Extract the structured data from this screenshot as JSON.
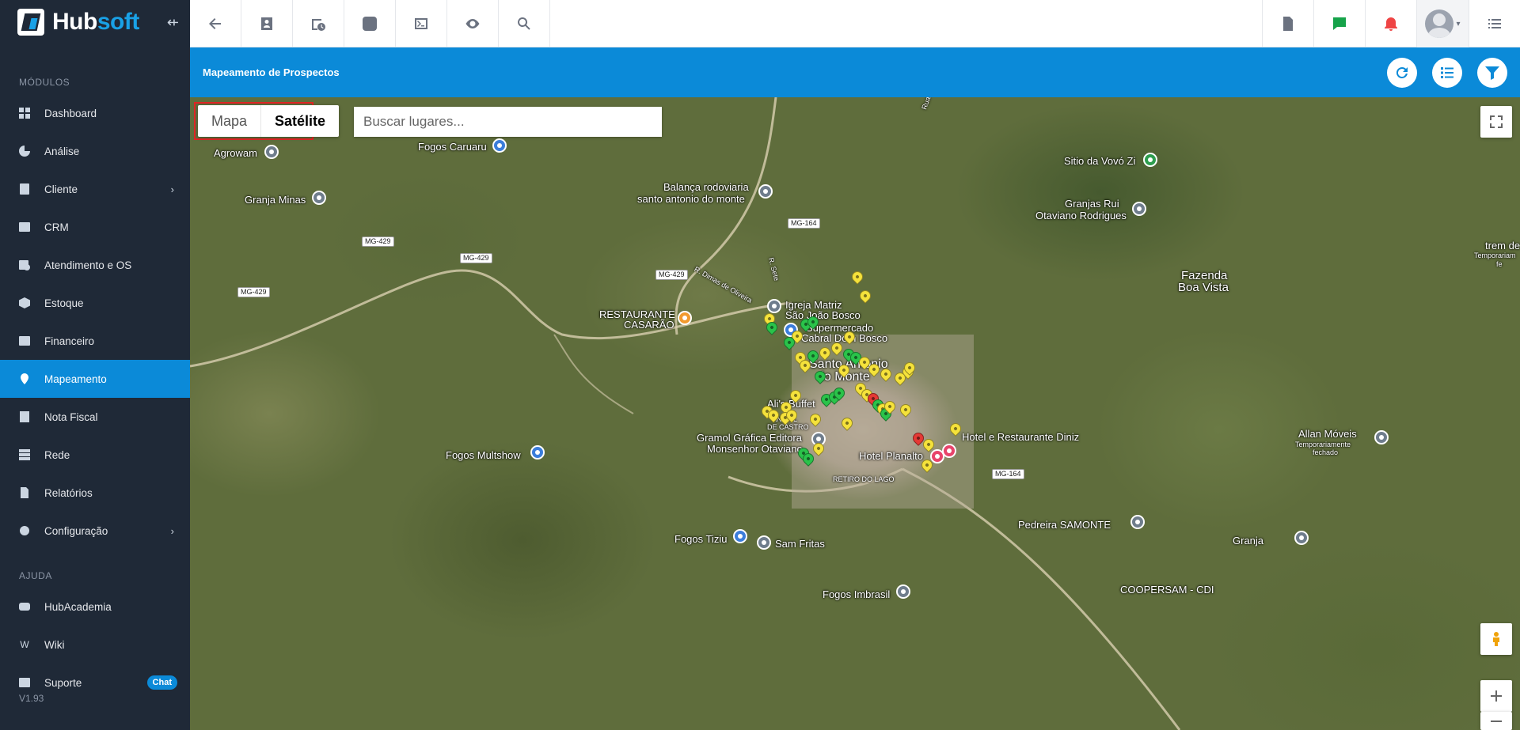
{
  "brand": {
    "name_a": "Hub",
    "name_b": "soft"
  },
  "sidebar": {
    "section_modules": "MÓDULOS",
    "items": [
      {
        "label": "Dashboard",
        "icon": "dashboard-icon"
      },
      {
        "label": "Análise",
        "icon": "pie-chart-icon"
      },
      {
        "label": "Cliente",
        "icon": "id-card-icon",
        "has_children": true
      },
      {
        "label": "CRM",
        "icon": "crm-icon"
      },
      {
        "label": "Atendimento e OS",
        "icon": "calendar-clock-icon"
      },
      {
        "label": "Estoque",
        "icon": "box-icon"
      },
      {
        "label": "Financeiro",
        "icon": "money-icon"
      },
      {
        "label": "Mapeamento",
        "icon": "map-pin-icon",
        "active": true
      },
      {
        "label": "Nota Fiscal",
        "icon": "invoice-icon"
      },
      {
        "label": "Rede",
        "icon": "network-icon"
      },
      {
        "label": "Relatórios",
        "icon": "report-icon"
      },
      {
        "label": "Configuração",
        "icon": "gear-icon",
        "has_children": true
      }
    ],
    "section_help": "AJUDA",
    "help_items": [
      {
        "label": "HubAcademia",
        "icon": "youtube-icon"
      },
      {
        "label": "Wiki",
        "icon": "wikipedia-icon"
      },
      {
        "label": "Suporte",
        "icon": "chat-icon",
        "badge": "Chat"
      }
    ],
    "version": "V1.93"
  },
  "page": {
    "title": "Mapeamento de Prospectos"
  },
  "map": {
    "map_type_map": "Mapa",
    "map_type_satellite": "Satélite",
    "search_placeholder": "Buscar lugares...",
    "places": {
      "agrowam": "Agrowam",
      "fogos_caruaru": "Fogos Caruaru",
      "granja_minas": "Granja Minas",
      "balanca_1": "Balança rodoviaria",
      "balanca_2": "santo antonio do monte",
      "sitio": "Sitio da Vovó Zi",
      "granjas_1": "Granjas Rui",
      "granjas_2": "Otaviano Rodrigues",
      "fazenda_1": "Fazenda",
      "fazenda_2": "Boa Vista",
      "trem_1": "trem de",
      "trem_2": "Temporariam",
      "trem_3": "fe",
      "igreja_1": "Igreja Matriz",
      "igreja_2": "São João Bosco",
      "super_1": "Supermercado",
      "super_2": "Cabral Dom Bosco",
      "rest_1": "RESTAURANTE",
      "rest_2": "CASARÃO",
      "city_1": "Santo Antonio",
      "city_2": "do Monte",
      "buffet": "Ali's Buffet",
      "anibal_1": "ANIBAL",
      "anibal_2": "DE CASTRO",
      "gramol_1": "Gramol Gráfica Editora",
      "gramol_2": "Monsenhor Otaviano",
      "hotel_diniz": "Hotel e Restaurante Diniz",
      "hotel_planalto": "Hotel Planalto",
      "retiro": "RETIRO DO LAGO",
      "allan_1": "Allan Móveis",
      "allan_2": "Temporariamente",
      "allan_3": "fechado",
      "fogos_multshow": "Fogos Multshow",
      "pedreira": "Pedreira SAMONTE",
      "granja": "Granja",
      "fogos_tiziu": "Fogos Tiziu",
      "sam_fritas": "Sam Fritas",
      "fogos_imbrasil": "Fogos Imbrasil",
      "coopersam": "COOPERSAM - CDI",
      "rua_dimas": "R. Dimas de Oliveira",
      "rua_sete": "R. Sete",
      "road_mg429a": "MG-429",
      "road_mg429b": "MG-429",
      "road_mg429c": "MG-429",
      "road_mg429d": "MG-429",
      "road_mg164a": "MG-164",
      "road_mg164b": "MG-164",
      "road_top": "Rua"
    }
  }
}
